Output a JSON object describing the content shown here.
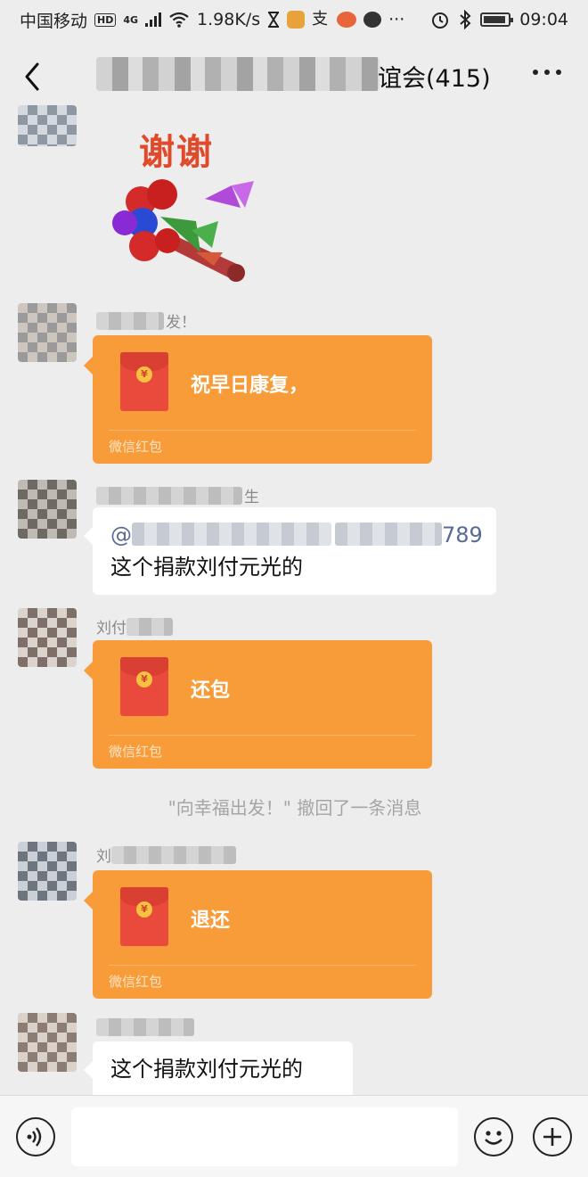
{
  "status_bar": {
    "carrier": "中国移动",
    "hd": "HD",
    "network": "4G",
    "speed": "1.98K/s",
    "time": "09:04",
    "battery_level": 0.9
  },
  "title_bar": {
    "title_suffix": "谊会(415)"
  },
  "messages": [
    {
      "sticker_text": "谢谢"
    },
    {
      "nick_suffix": "发！",
      "packet_text": "祝早日康复，",
      "packet_label": "微信红包"
    },
    {
      "nick_suffix": "生",
      "mention_prefix": "@",
      "mention_suffix": "789",
      "text": "这个捐款刘付元光的"
    },
    {
      "nick_prefix": "刘付",
      "packet_text": "还包",
      "packet_label": "微信红包"
    },
    {
      "nick_prefix": "刘",
      "packet_text": "退还",
      "packet_label": "微信红包"
    },
    {
      "text": "这个捐款刘付元光的"
    }
  ],
  "system_message": "\"向幸福出发！\" 撤回了一条消息",
  "icons": {
    "back": "back-arrow-icon",
    "more": "more-dots-icon",
    "voice": "voice-icon",
    "emoji": "emoji-icon",
    "plus": "plus-icon"
  }
}
